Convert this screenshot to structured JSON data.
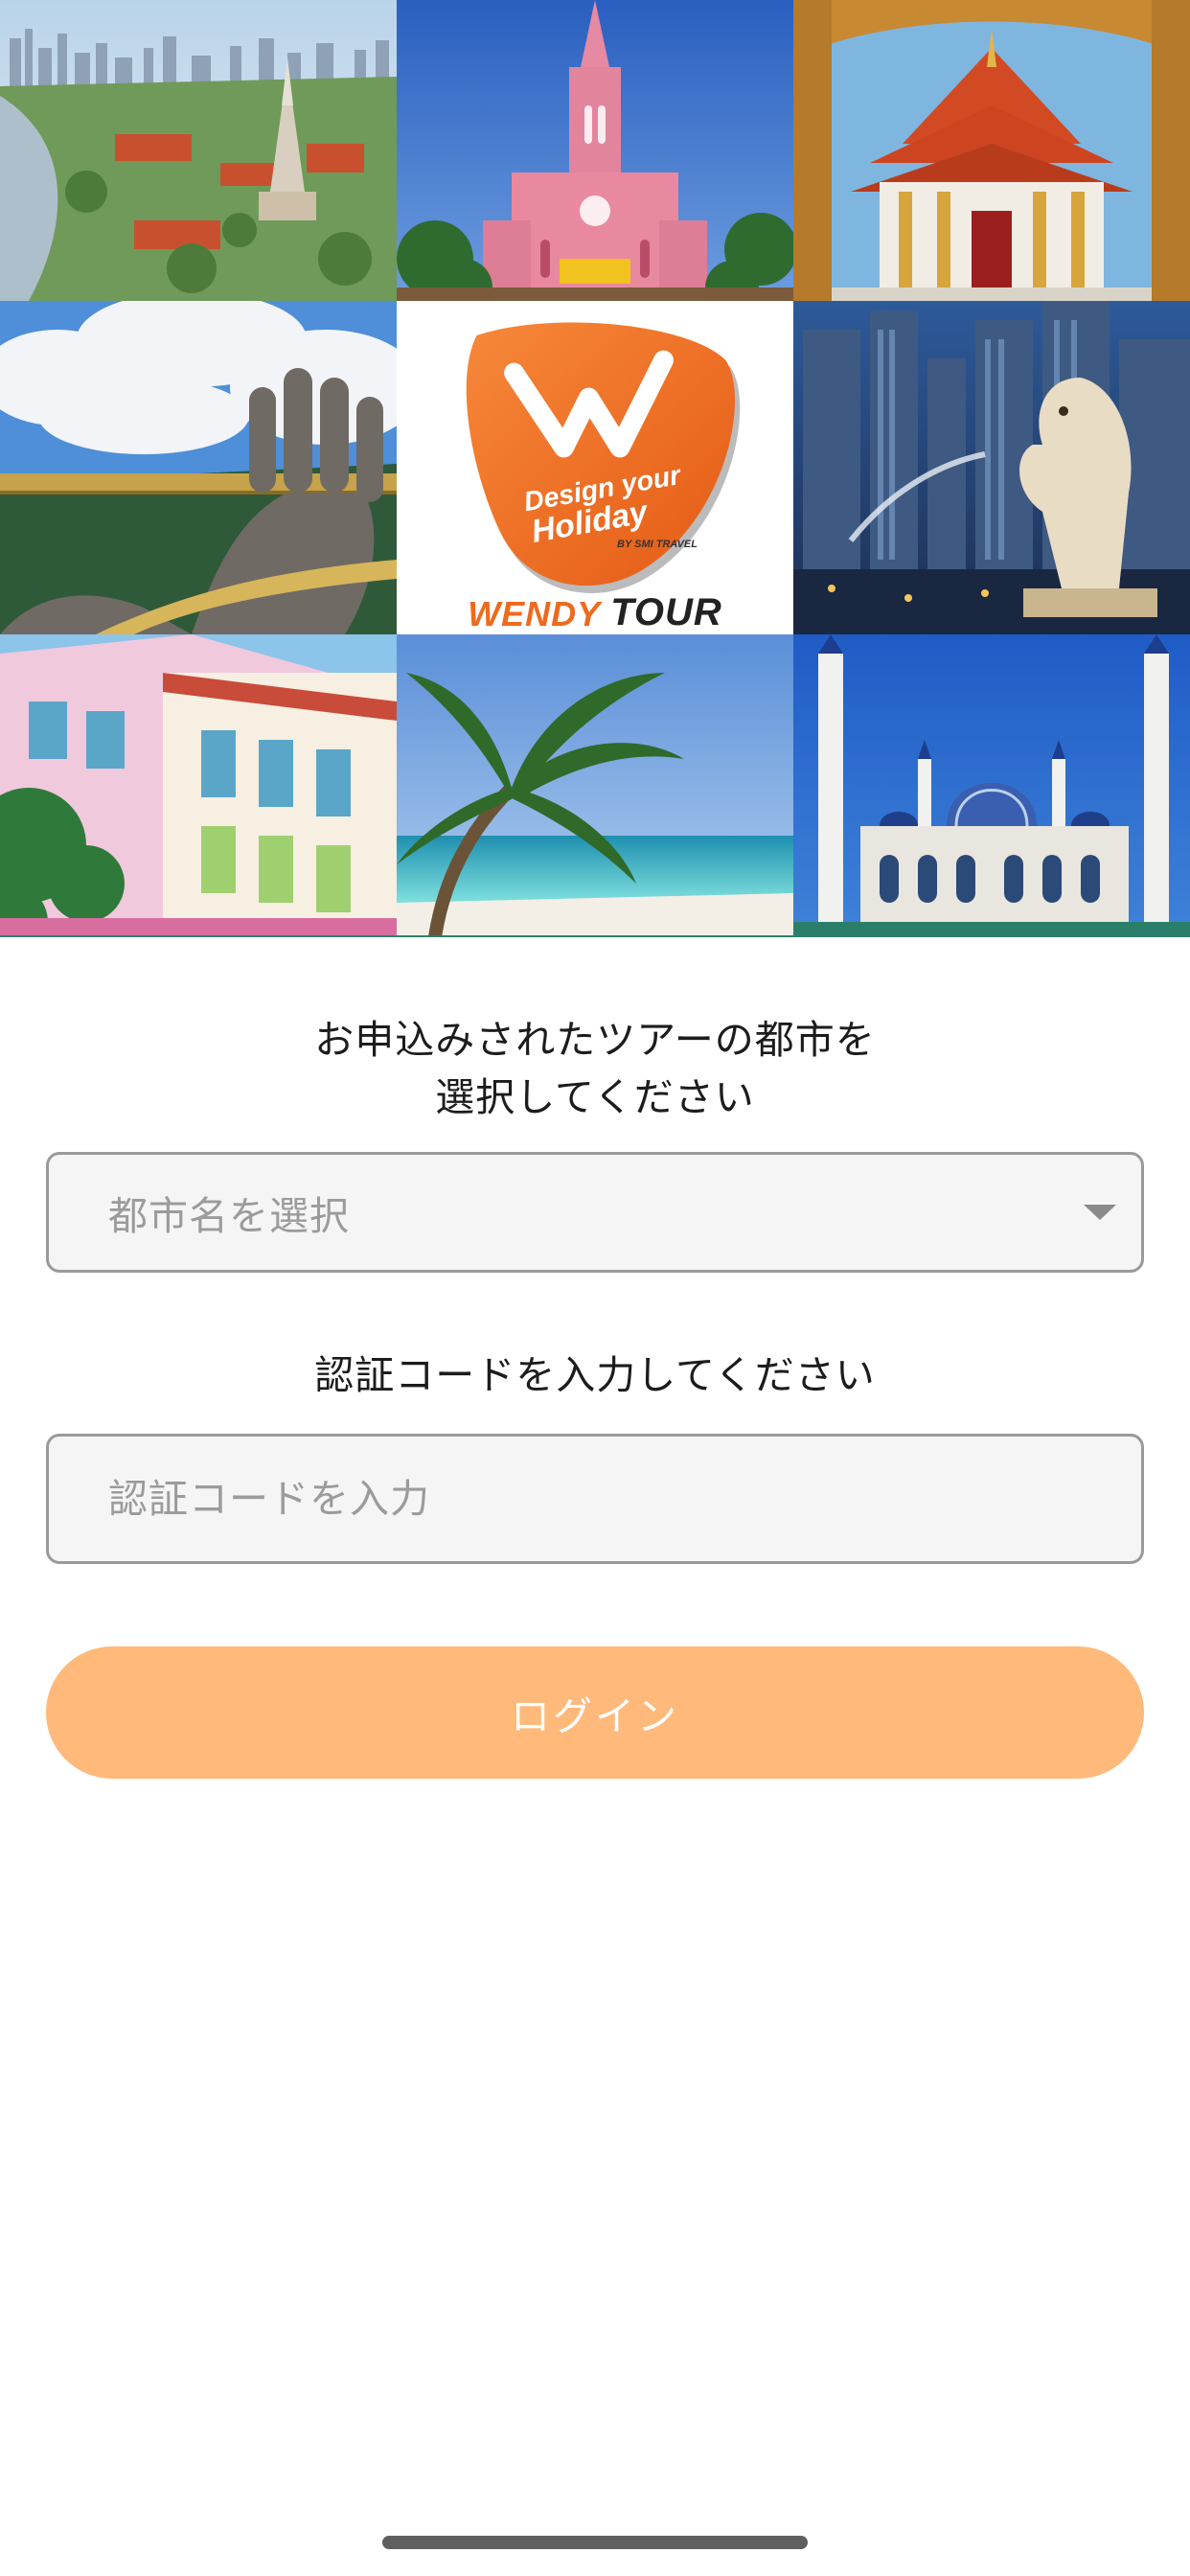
{
  "brand": {
    "tagline_line1": "Design your",
    "tagline_line2": "Holiday",
    "by_line": "BY SMI TRAVEL",
    "name_part1": "WENDY",
    "name_part2": "TOUR",
    "accent_color": "#ee6a1c"
  },
  "photos": [
    {
      "name": "bangkok-skyline-photo"
    },
    {
      "name": "pink-cathedral-photo"
    },
    {
      "name": "thai-temple-photo"
    },
    {
      "name": "golden-bridge-hands-photo"
    },
    {
      "name": "merlion-photo"
    },
    {
      "name": "colorful-shophouses-photo"
    },
    {
      "name": "palm-beach-photo"
    },
    {
      "name": "blue-mosque-photo"
    }
  ],
  "form": {
    "city_prompt_line1": "お申込みされたツアーの都市を",
    "city_prompt_line2": "選択してください",
    "city_select_placeholder": "都市名を選択",
    "code_prompt": "認証コードを入力してください",
    "code_input_placeholder": "認証コードを入力",
    "login_label": "ログイン",
    "button_color": "#ffb97a"
  }
}
